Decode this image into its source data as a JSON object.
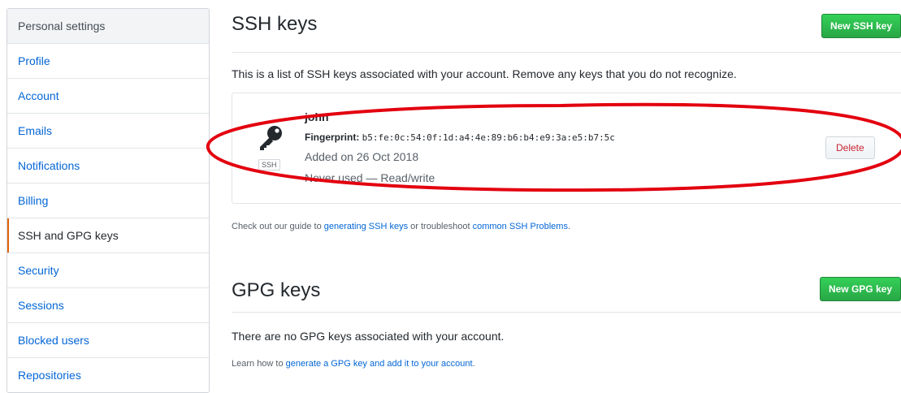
{
  "sidebar": {
    "header": "Personal settings",
    "items": [
      {
        "label": "Profile"
      },
      {
        "label": "Account"
      },
      {
        "label": "Emails"
      },
      {
        "label": "Notifications"
      },
      {
        "label": "Billing"
      },
      {
        "label": "SSH and GPG keys",
        "selected": true
      },
      {
        "label": "Security"
      },
      {
        "label": "Sessions"
      },
      {
        "label": "Blocked users"
      },
      {
        "label": "Repositories"
      }
    ]
  },
  "ssh": {
    "title": "SSH keys",
    "new_button": "New SSH key",
    "description": "This is a list of SSH keys associated with your account. Remove any keys that you do not recognize.",
    "key": {
      "badge": "SSH",
      "name": "john",
      "fingerprint_label": "Fingerprint:",
      "fingerprint": "b5:fe:0c:54:0f:1d:a4:4e:89:b6:b4:e9:3a:e5:b7:5c",
      "added": "Added on 26 Oct 2018",
      "usage": "Never used — Read/write",
      "delete_button": "Delete"
    },
    "guide": {
      "prefix": "Check out our guide to ",
      "link1": "generating SSH keys",
      "middle": " or troubleshoot ",
      "link2": "common SSH Problems",
      "suffix": "."
    }
  },
  "gpg": {
    "title": "GPG keys",
    "new_button": "New GPG key",
    "empty_text": "There are no GPG keys associated with your account.",
    "learn": {
      "prefix": "Learn how to ",
      "link": "generate a GPG key and add it to your account",
      "suffix": "."
    }
  },
  "colors": {
    "accent_selected": "#e36209",
    "link": "#0366d6",
    "primary_button": "#28a745",
    "annotation": "#e3000f"
  },
  "icons": {
    "key": "key-icon"
  }
}
